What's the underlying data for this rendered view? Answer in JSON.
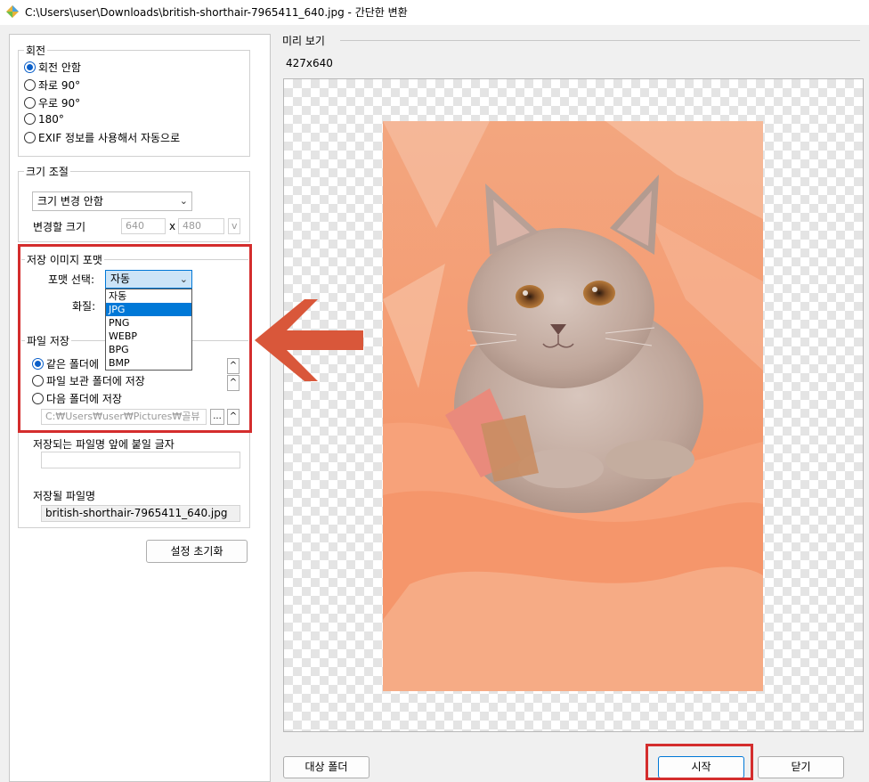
{
  "window": {
    "title": "C:\\Users\\user\\Downloads\\british-shorthair-7965411_640.jpg - 간단한 변환"
  },
  "rotation": {
    "title": "회전",
    "options": [
      "회전 안함",
      "좌로 90°",
      "우로 90°",
      "180°",
      "EXIF 정보를 사용해서 자동으로"
    ],
    "selected_index": 0
  },
  "resize": {
    "title": "크기 조절",
    "mode_value": "크기 변경 안함",
    "size_label": "변경할 크기",
    "width": "640",
    "x_sep": "x",
    "height": "480",
    "dropdown_btn": "v"
  },
  "format": {
    "title": "저장 이미지 포맷",
    "select_label": "포맷 선택:",
    "selected": "자동",
    "quality_label": "화질:",
    "options": [
      "자동",
      "JPG",
      "PNG",
      "WEBP",
      "BPG",
      "BMP"
    ],
    "highlighted_index": 1
  },
  "save": {
    "title": "파일 저장",
    "options": [
      "같은 폴더에",
      "파일 보관 폴더에 저장",
      "다음 폴더에 저장"
    ],
    "selected_index": 0,
    "folder_path": "C:₩Users₩user₩Pictures₩골뷰",
    "browse_label": "...",
    "up_label": "^",
    "prefix_label": "저장되는 파일명 앞에 붙일 글자",
    "prefix_value": "",
    "filename_label": "저장될 파일명",
    "filename_value": "british-shorthair-7965411_640.jpg"
  },
  "reset_button": "설정 초기화",
  "preview": {
    "title": "미리 보기",
    "dimensions": "427x640"
  },
  "buttons": {
    "target_folder": "대상 폴더",
    "start": "시작",
    "close": "닫기"
  },
  "colors": {
    "highlight": "#d42d2d",
    "arrow": "#d9573a",
    "selection": "#0078d7"
  },
  "icons": [
    "app-icon",
    "chevron-down-icon",
    "left-arrow-icon"
  ]
}
